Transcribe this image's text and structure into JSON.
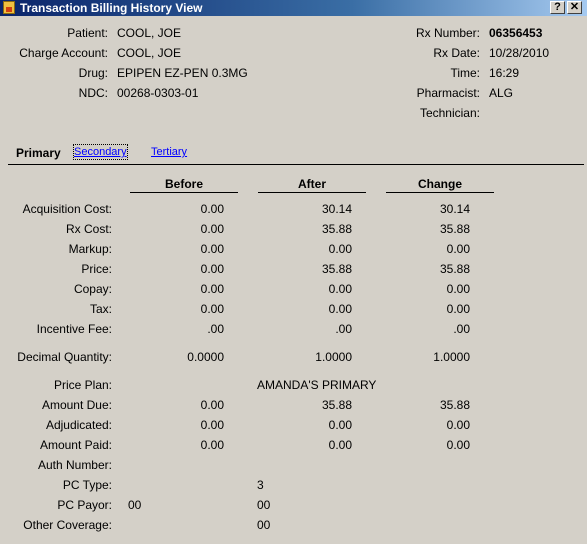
{
  "window": {
    "title": "Transaction Billing History View",
    "help_glyph": "?",
    "close_glyph": "✕"
  },
  "header": {
    "left": [
      {
        "label": "Patient:",
        "value": "COOL, JOE"
      },
      {
        "label": "Charge Account:",
        "value": "COOL, JOE"
      },
      {
        "label": "Drug:",
        "value": "EPIPEN EZ-PEN 0.3MG"
      },
      {
        "label": "NDC:",
        "value": "00268-0303-01"
      }
    ],
    "right": [
      {
        "label": "Rx Number:",
        "value": "06356453"
      },
      {
        "label": "Rx Date:",
        "value": "10/28/2010"
      },
      {
        "label": "Time:",
        "value": "16:29"
      },
      {
        "label": "Pharmacist:",
        "value": "ALG"
      },
      {
        "label": "Technician:",
        "value": ""
      }
    ]
  },
  "tabs": {
    "primary": "Primary",
    "secondary": "Secondary",
    "tertiary": "Tertiary"
  },
  "columns": {
    "before": "Before",
    "after": "After",
    "change": "Change"
  },
  "rows": [
    {
      "label": "Acquisition Cost:",
      "before": "0.00",
      "after": "30.14",
      "change": "30.14"
    },
    {
      "label": "Rx Cost:",
      "before": "0.00",
      "after": "35.88",
      "change": "35.88"
    },
    {
      "label": "Markup:",
      "before": "0.00",
      "after": "0.00",
      "change": "0.00"
    },
    {
      "label": "Price:",
      "before": "0.00",
      "after": "35.88",
      "change": "35.88"
    },
    {
      "label": "Copay:",
      "before": "0.00",
      "after": "0.00",
      "change": "0.00"
    },
    {
      "label": "Tax:",
      "before": "0.00",
      "after": "0.00",
      "change": "0.00"
    },
    {
      "label": "Incentive Fee:",
      "before": ".00",
      "after": ".00",
      "change": ".00"
    },
    {
      "label": "Decimal Quantity:",
      "before": "0.0000",
      "after": "1.0000",
      "change": "1.0000"
    }
  ],
  "price_plan": {
    "label": "Price Plan:",
    "value": "AMANDA'S PRIMARY"
  },
  "rows2": [
    {
      "label": "Amount Due:",
      "before": "0.00",
      "after": "35.88",
      "change": "35.88"
    },
    {
      "label": "Adjudicated:",
      "before": "0.00",
      "after": "0.00",
      "change": "0.00"
    },
    {
      "label": "Amount Paid:",
      "before": "0.00",
      "after": "0.00",
      "change": "0.00"
    }
  ],
  "misc": [
    {
      "label": "Auth Number:",
      "before": "",
      "after": ""
    },
    {
      "label": "PC Type:",
      "before": "",
      "after": "3"
    },
    {
      "label": "PC Payor:",
      "before": "00",
      "after": "00"
    },
    {
      "label": "Other Coverage:",
      "before": "",
      "after": "00"
    }
  ]
}
